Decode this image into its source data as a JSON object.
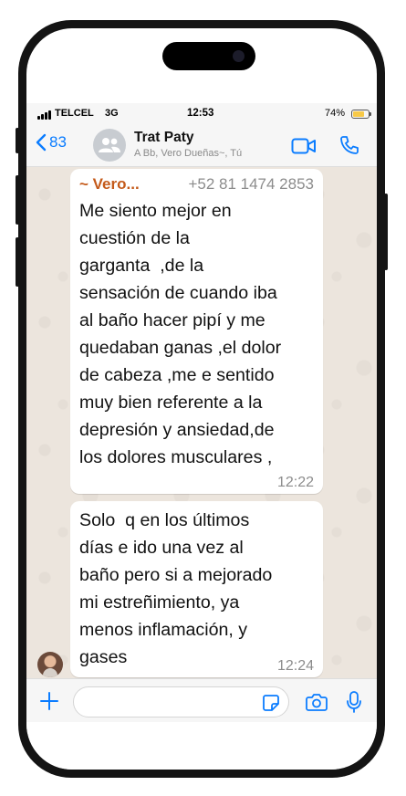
{
  "status_bar": {
    "carrier": "TELCEL",
    "network": "3G",
    "time": "12:53",
    "battery": "74%",
    "battery_level": 0.74
  },
  "header": {
    "back_count": "83",
    "title": "Trat Paty",
    "subtitle": "A Bb, Vero Dueñas~, Tú"
  },
  "messages": [
    {
      "sender": "~ Vero...",
      "phone": "+52 81 1474 2853",
      "text": "Me siento mejor en\ncuestión de la\ngarganta  ,de la\nsensación de cuando iba\nal baño hacer pipí y me\nquedaban ganas ,el dolor\nde cabeza ,me e sentido\nmuy bien referente a la\ndepresión y ansiedad,de\nlos dolores musculares ,",
      "time": "12:22"
    },
    {
      "text": "Solo  q en los últimos\ndías e ido una vez al\nbaño pero si a mejorado\nmi estreñimiento, ya\nmenos inflamación, y\ngases",
      "time": "12:24"
    }
  ],
  "input": {
    "value": "",
    "placeholder": ""
  },
  "colors": {
    "accent": "#0a7cff",
    "sender_name": "#c45a1a",
    "chat_background": "#ece5dd",
    "battery_fill": "#f7c948"
  }
}
